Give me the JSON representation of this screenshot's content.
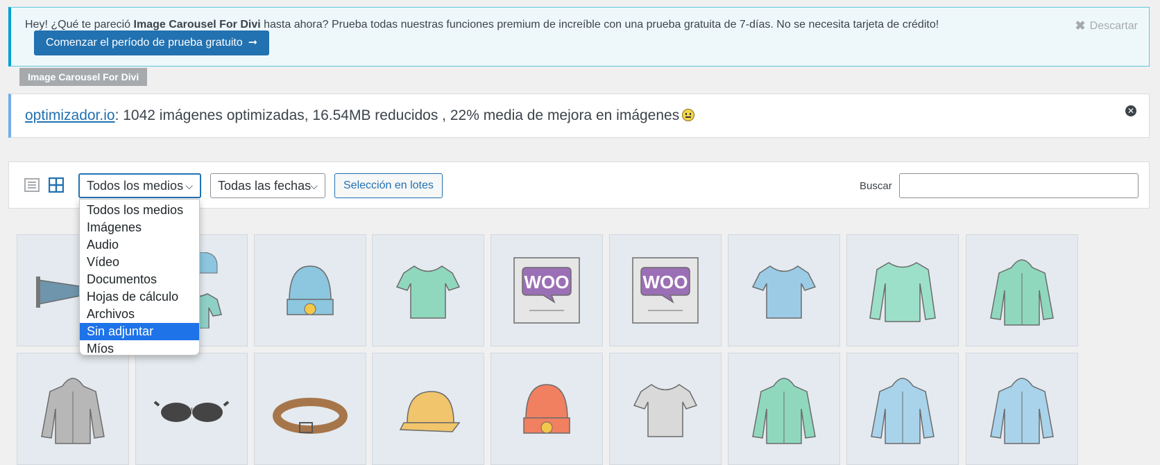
{
  "trial_notice": {
    "prefix": "Hey! ¿Qué te pareció ",
    "product": "Image Carousel For Divi",
    "suffix": " hasta ahora? Prueba todas nuestras funciones premium de increíble con una prueba gratuita de 7-días. No se necesita tarjeta de crédito!",
    "button_label": "Comenzar el período de prueba gratuito",
    "button_arrow": "➞",
    "dismiss_label": "Descartar",
    "tag": "Image Carousel For Divi"
  },
  "optimizer_notice": {
    "link": "optimizador.io",
    "text": ": 1042 imágenes optimizadas, 16.54MB reducidos , 22% media de mejora en imágenes"
  },
  "toolbar": {
    "media_filter": "Todos los medios",
    "date_filter": "Todas las fechas",
    "bulk_select": "Selección en lotes",
    "search_label": "Buscar",
    "search_value": ""
  },
  "dropdown": {
    "options": [
      "Todos los medios",
      "Imágenes",
      "Audio",
      "Vídeo",
      "Documentos",
      "Hojas de cálculo",
      "Archivos",
      "Sin adjuntar",
      "Míos"
    ],
    "selected": "Sin adjuntar"
  },
  "media_tiles": [
    "wordpress-pennant",
    "hoodie-tshirt-beanie-set",
    "beanie",
    "vneck-tshirt",
    "woo-single-album",
    "woo-album",
    "polo-shirt",
    "long-sleeve-tee",
    "hoodie-zipper",
    "hoodie-grey",
    "sunglasses",
    "belt",
    "cap",
    "beanie-orange",
    "tshirt-grey",
    "hoodie-green",
    "hoodie-blue-logo",
    "hoodie-blue"
  ],
  "colors": {
    "primary": "#2271b1",
    "notice_border": "#00a0d2",
    "selected_option": "#1e73e8"
  }
}
